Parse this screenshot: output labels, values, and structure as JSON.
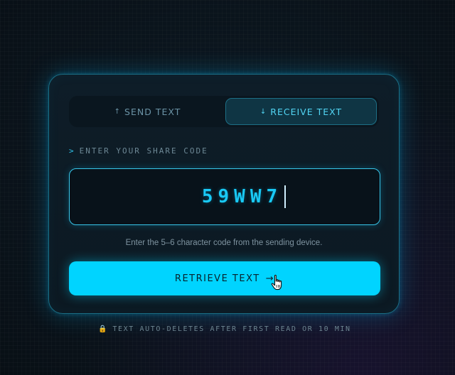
{
  "tabs": {
    "send": {
      "arrow": "↑",
      "label": "SEND TEXT"
    },
    "receive": {
      "arrow": "↓",
      "label": "RECEIVE TEXT"
    }
  },
  "code_section": {
    "prompt": ">",
    "label": "ENTER YOUR SHARE CODE",
    "value": "59WW7",
    "hint": "Enter the 5–6 character code from the sending device."
  },
  "retrieve_button": {
    "label": "RETRIEVE TEXT",
    "arrow": "→"
  },
  "footer": {
    "lock_icon": "🔒",
    "note": "TEXT AUTO-DELETES AFTER FIRST READ OR 10 MIN"
  },
  "colors": {
    "accent": "#00d4ff",
    "card_border": "#1b6f86",
    "background": "#0a131b"
  },
  "icons": {
    "cursor": "hand-pointer-icon",
    "lock": "lock-icon"
  }
}
